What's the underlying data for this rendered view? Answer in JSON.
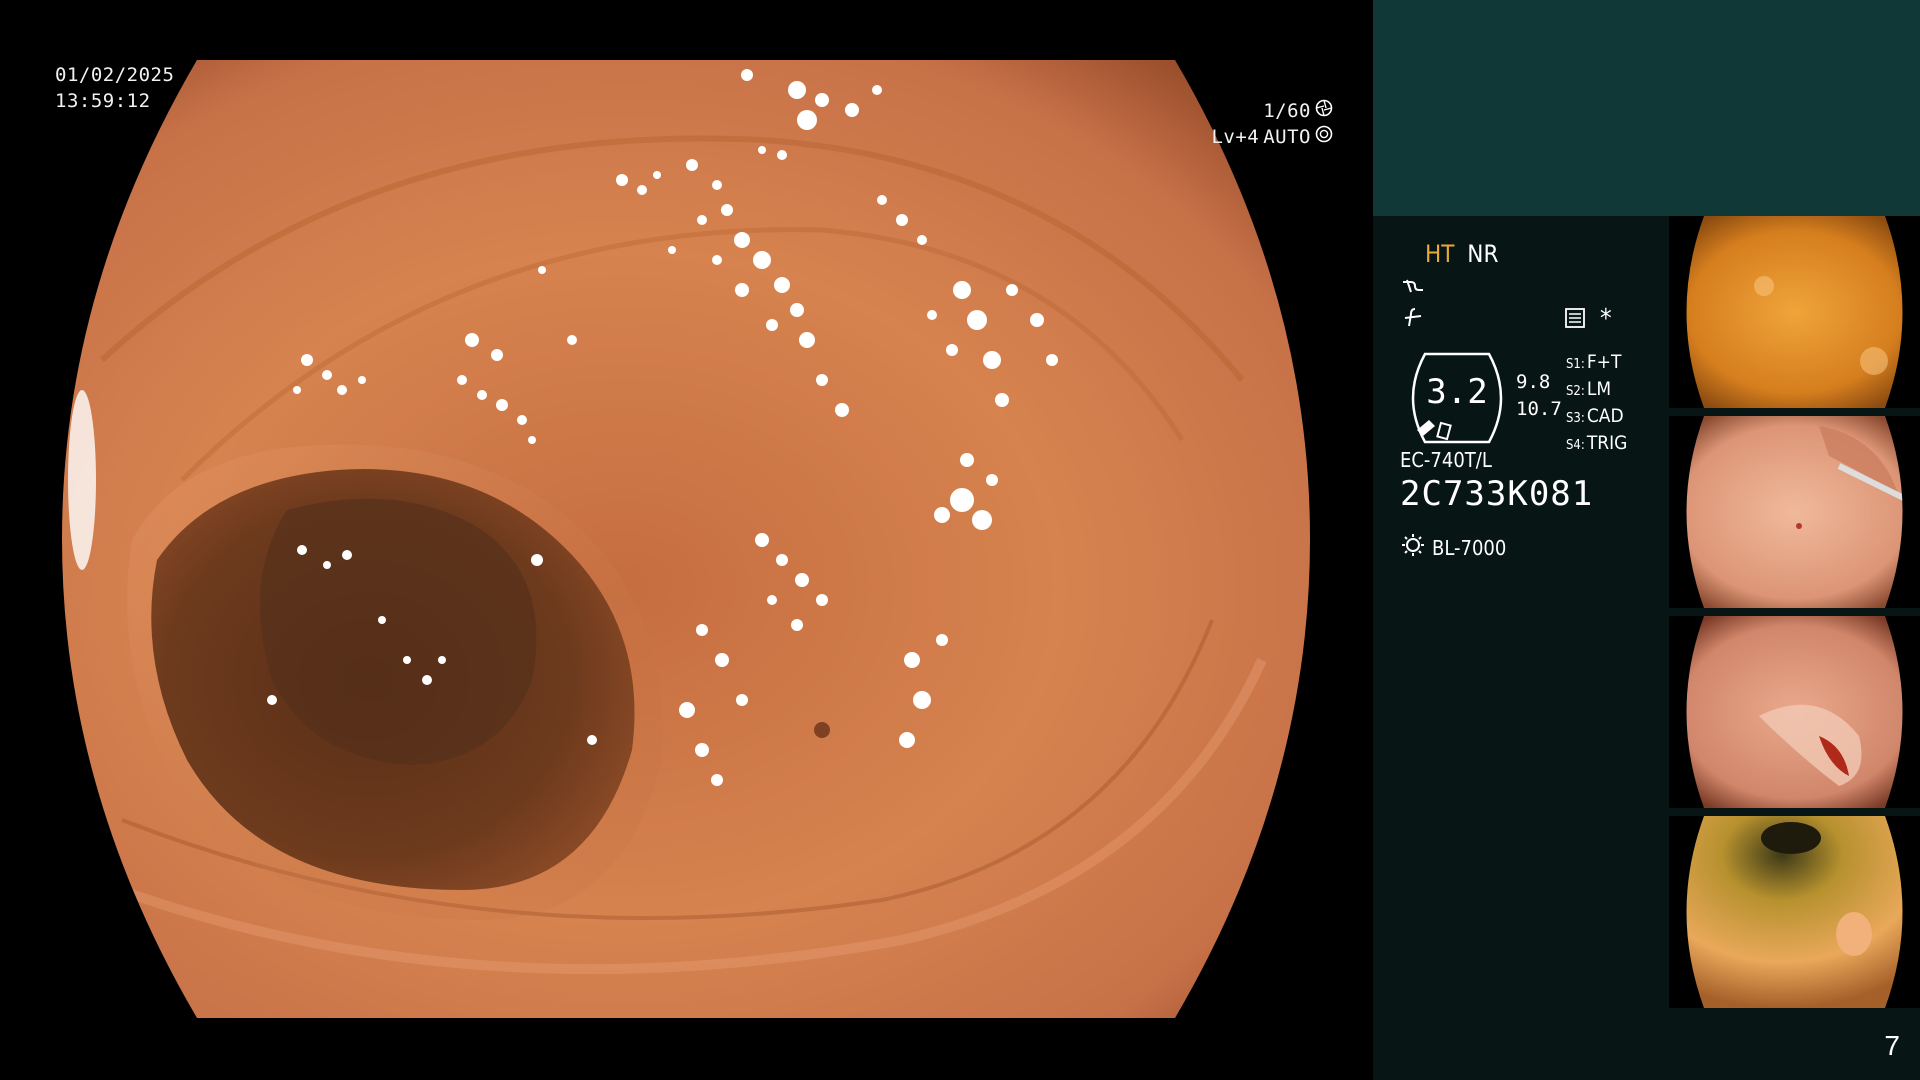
{
  "osd": {
    "date": "01/02/2025",
    "time": "13:59:12",
    "shutter": "1/60",
    "level": "Lv+4",
    "mode": "AUTO"
  },
  "panel": {
    "ht": "HT",
    "nr": "NR",
    "gauge_value": "3.2",
    "gauge_sub1": "9.8",
    "gauge_sub2": "10.7",
    "asterisk": "*",
    "switches": [
      {
        "key": "S1:",
        "value": "F+T"
      },
      {
        "key": "S2:",
        "value": "LM"
      },
      {
        "key": "S3:",
        "value": "CAD"
      },
      {
        "key": "S4:",
        "value": "TRIG"
      }
    ],
    "scope_model": "EC-740T/L",
    "scope_serial": "2C733K081",
    "light_source": "BL-7000",
    "frame_number": "7"
  },
  "colors": {
    "panel_top": "#0f3836",
    "panel_bg": "#071614",
    "ht_accent": "#e8a93a",
    "mucosa": "#d97f4d"
  },
  "icons": [
    "shutter-icon",
    "auto-iris-icon",
    "curve-icon",
    "f-icon",
    "menu-icon",
    "gauge-icon",
    "light-bulb-icon"
  ]
}
